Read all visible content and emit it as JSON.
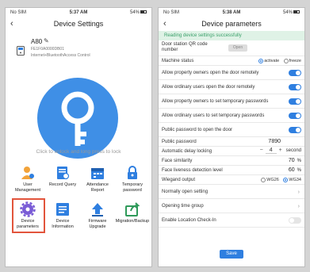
{
  "left": {
    "status": {
      "carrier": "No SIM",
      "time": "5:37 AM",
      "battery": "54%"
    },
    "title": "Device Settings",
    "device": {
      "name": "A80",
      "serial": "FE1F0A0000DB01",
      "access": "Internet+BluetoothAccess Control"
    },
    "hint": "Click to unlock and long press to lock",
    "grid": [
      {
        "label": "User Management",
        "icon": "user-icon"
      },
      {
        "label": "Record Query",
        "icon": "record-icon"
      },
      {
        "label": "Attendance Report",
        "icon": "calendar-icon"
      },
      {
        "label": "Temporary password",
        "icon": "lock-icon"
      },
      {
        "label": "Device parameters",
        "icon": "gear-icon"
      },
      {
        "label": "Device Information",
        "icon": "info-icon"
      },
      {
        "label": "Firmware Upgrade",
        "icon": "upload-icon"
      },
      {
        "label": "Migration/Backup",
        "icon": "share-icon"
      }
    ]
  },
  "right": {
    "status": {
      "carrier": "No SIM",
      "time": "5:38 AM",
      "battery": "54%"
    },
    "title": "Device parameters",
    "notice": "Reading device settings successfully",
    "qr": {
      "label": "Door station QR code number",
      "button": "Open"
    },
    "machine_status": {
      "label": "Machine status",
      "option1": "activate",
      "option2": "freeze"
    },
    "toggles": [
      {
        "label": "Allow property owners open the door remotely",
        "on": true
      },
      {
        "label": "Allow ordinary users open the door remotely",
        "on": true
      },
      {
        "label": "Allow property owners to set temporary passwords",
        "on": true
      },
      {
        "label": "Allow ordinary users to set temporary passwords",
        "on": true
      },
      {
        "label": "Public password to open the door",
        "on": true
      }
    ],
    "public_password": {
      "label": "Public password",
      "value": "7890"
    },
    "auto_lock": {
      "label": "Automatic delay locking",
      "minus": "−",
      "value": "4",
      "plus": "+",
      "unit": "second"
    },
    "face_similarity": {
      "label": "Face similarity",
      "value": "70",
      "unit": "%"
    },
    "face_liveness": {
      "label": "Face liveness detection level",
      "value": "60",
      "unit": "%"
    },
    "wiegand": {
      "label": "Wiegand output",
      "option1": "WG26",
      "option2": "WG34"
    },
    "normally_open": "Normally open setting",
    "opening_time": "Opening time group",
    "location_checkin": "Enable Location Check-In",
    "save": "Save"
  }
}
